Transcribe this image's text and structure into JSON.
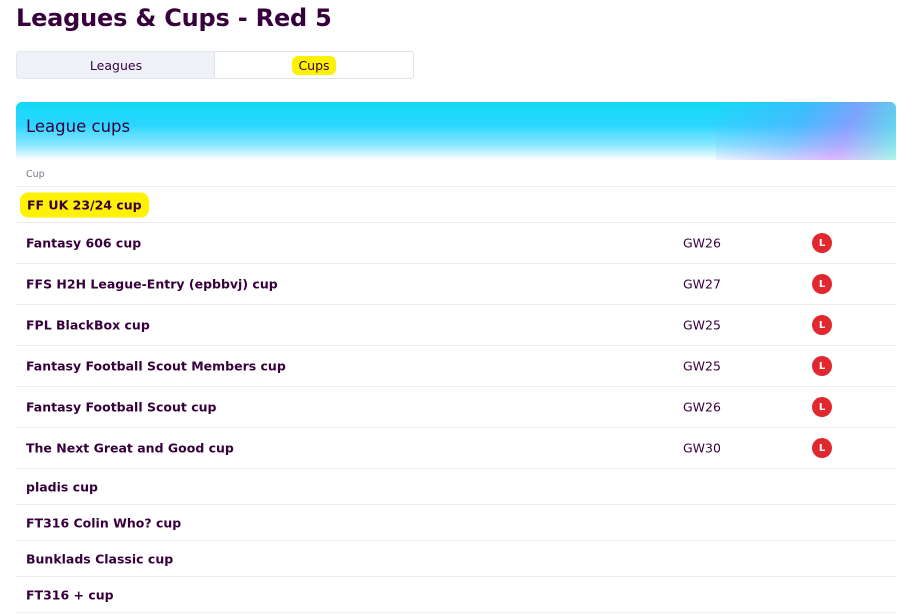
{
  "page": {
    "title": "Leagues & Cups - Red 5"
  },
  "tabs": [
    {
      "label": "Leagues",
      "active": false
    },
    {
      "label": "Cups",
      "active": true
    }
  ],
  "panel": {
    "title": "League cups",
    "column_header": "Cup"
  },
  "cups": [
    {
      "name": "FF UK 23/24 cup",
      "gw": "",
      "result": ""
    },
    {
      "name": "Fantasy 606 cup",
      "gw": "GW26",
      "result": "L"
    },
    {
      "name": "FFS H2H League-Entry (epbbvj) cup",
      "gw": "GW27",
      "result": "L"
    },
    {
      "name": "FPL BlackBox cup",
      "gw": "GW25",
      "result": "L"
    },
    {
      "name": "Fantasy Football Scout Members cup",
      "gw": "GW25",
      "result": "L"
    },
    {
      "name": "Fantasy Football Scout cup",
      "gw": "GW26",
      "result": "L"
    },
    {
      "name": "The Next Great and Good cup",
      "gw": "GW30",
      "result": "L"
    },
    {
      "name": "pladis cup",
      "gw": "",
      "result": ""
    },
    {
      "name": "FT316 Colin Who? cup",
      "gw": "",
      "result": ""
    },
    {
      "name": "Bunklads Classic cup",
      "gw": "",
      "result": ""
    },
    {
      "name": "FT316 + cup",
      "gw": "",
      "result": ""
    }
  ],
  "colors": {
    "primary": "#37003c",
    "loss_badge": "#e0282e",
    "highlight": "#fff200"
  }
}
